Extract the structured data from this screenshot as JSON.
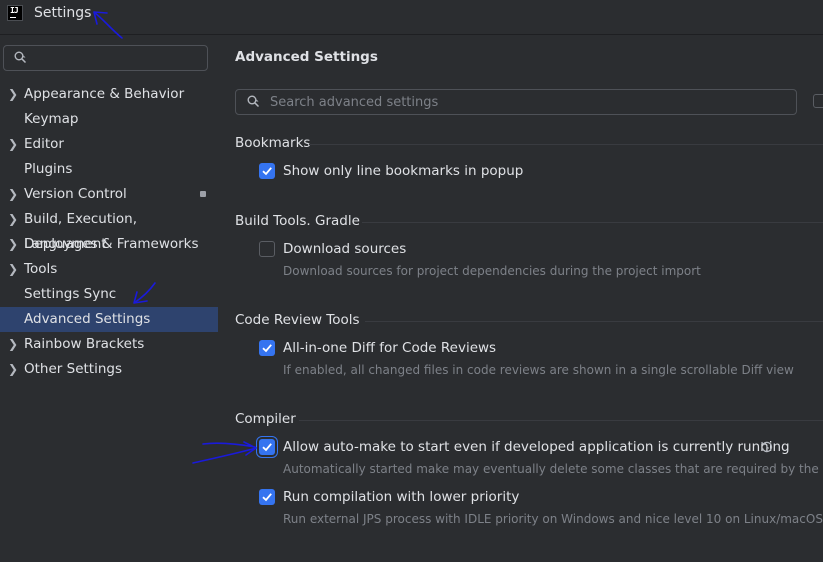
{
  "window": {
    "title": "Settings",
    "app_icon_text": "IJ"
  },
  "sidebar": {
    "search": {
      "value": "",
      "placeholder": ""
    },
    "items": [
      {
        "label": "Appearance & Behavior",
        "expandable": true,
        "selected": false
      },
      {
        "label": "Keymap",
        "expandable": false,
        "selected": false
      },
      {
        "label": "Editor",
        "expandable": true,
        "selected": false
      },
      {
        "label": "Plugins",
        "expandable": false,
        "selected": false
      },
      {
        "label": "Version Control",
        "expandable": true,
        "selected": false,
        "badge": true
      },
      {
        "label": "Build, Execution, Deployment",
        "expandable": true,
        "selected": false
      },
      {
        "label": "Languages & Frameworks",
        "expandable": true,
        "selected": false
      },
      {
        "label": "Tools",
        "expandable": true,
        "selected": false
      },
      {
        "label": "Settings Sync",
        "expandable": false,
        "selected": false
      },
      {
        "label": "Advanced Settings",
        "expandable": false,
        "selected": true
      },
      {
        "label": "Rainbow Brackets",
        "expandable": true,
        "selected": false
      },
      {
        "label": "Other Settings",
        "expandable": true,
        "selected": false
      }
    ]
  },
  "main": {
    "title": "Advanced Settings",
    "search": {
      "value": "",
      "placeholder": "Search advanced settings"
    },
    "groups": [
      {
        "title": "Bookmarks",
        "options": [
          {
            "label": "Show only line bookmarks in popup",
            "checked": true,
            "description": ""
          }
        ]
      },
      {
        "title": "Build Tools. Gradle",
        "options": [
          {
            "label": "Download sources",
            "checked": false,
            "description": "Download sources for project dependencies during the project import"
          }
        ]
      },
      {
        "title": "Code Review Tools",
        "options": [
          {
            "label": "All-in-one Diff for Code Reviews",
            "checked": true,
            "description": "If enabled, all changed files in code reviews are shown in a single scrollable Diff view"
          }
        ]
      },
      {
        "title": "Compiler",
        "options": [
          {
            "label": "Allow auto-make to start even if developed application is currently running",
            "checked": true,
            "modified": true,
            "description": "Automatically started make may eventually delete some classes that are required by the application"
          },
          {
            "label": "Run compilation with lower priority",
            "checked": true,
            "description": "Run external JPS process with IDLE priority on Windows and nice level 10 on Linux/macOS"
          }
        ]
      }
    ]
  },
  "colors": {
    "background": "#2b2d30",
    "selection": "#2e436e",
    "accent": "#3574f0",
    "annotation": "#1a1adb"
  },
  "icons": [
    "app-icon",
    "search-icon",
    "chevron-right-icon",
    "checkmark-icon",
    "reset-icon"
  ]
}
